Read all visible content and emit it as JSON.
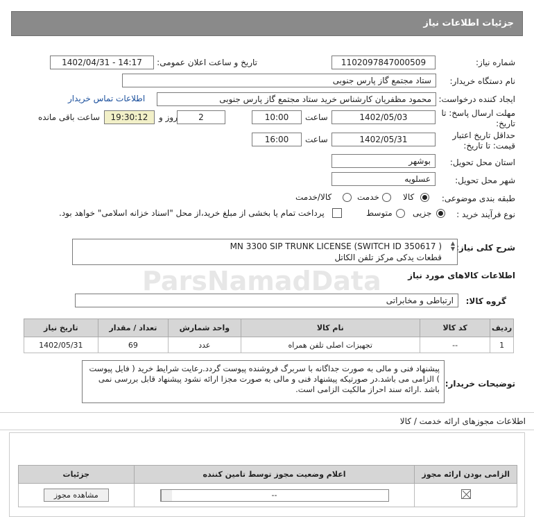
{
  "header": {
    "title": "جزئیات اطلاعات نیاز"
  },
  "form": {
    "need_number_label": "شماره نیاز:",
    "need_number": "1102097847000509",
    "announce_label": "تاریخ و ساعت اعلان عمومی:",
    "announce_value": "1402/04/31 - 14:17",
    "buyer_org_label": "نام دستگاه خریدار:",
    "buyer_org": "ستاد مجتمع گاز پارس جنوبی",
    "requester_label": "ایجاد کننده درخواست:",
    "requester": "محمود مظفریان کارشناس خرید ستاد مجتمع گاز پارس جنوبی",
    "contact_link": "اطلاعات تماس خریدار",
    "deadline_label": "مهلت ارسال پاسخ: تا",
    "deadline_label2": "تاریخ:",
    "deadline_date": "1402/05/03",
    "time_label": "ساعت",
    "deadline_time": "10:00",
    "days_value": "2",
    "days_label": "روز و",
    "remaining_time": "19:30:12",
    "remaining_label": "ساعت باقی مانده",
    "validity_label": "حداقل تاریخ اعتبار",
    "validity_label2": "قیمت: تا تاریخ:",
    "validity_date": "1402/05/31",
    "validity_time": "16:00",
    "province_label": "استان محل تحویل:",
    "province": "بوشهر",
    "city_label": "شهر محل تحویل:",
    "city": "عسلویه",
    "category_label": "طبقه بندی موضوعی:",
    "category_options": [
      "کالا",
      "خدمت",
      "کالا/خدمت"
    ],
    "purchase_type_label": "نوع فرآیند خرید :",
    "purchase_options": [
      "جزیی",
      "متوسط"
    ],
    "purchase_note": "پرداخت تمام یا بخشی از مبلغ خرید،از محل \"اسناد خزانه اسلامی\" خواهد بود."
  },
  "summary": {
    "label": "شرح کلی نیاز:",
    "line1": "MN 3300 SIP TRUNK LICENSE (SWITCH ID 350617 )",
    "line2": "قطعات یدکی مرکز تلفن الکاتل"
  },
  "goods": {
    "section_title": "اطلاعات کالاهای مورد نیاز",
    "group_label": "گروه کالا:",
    "group_value": "ارتباطی و مخابراتی",
    "columns": [
      "ردیف",
      "کد کالا",
      "نام کالا",
      "واحد شمارش",
      "تعداد / مقدار",
      "تاریخ نیاز"
    ],
    "rows": [
      {
        "row": "1",
        "code": "--",
        "name": "تجهیزات اصلی تلفن همراه",
        "unit": "عدد",
        "qty": "69",
        "date": "1402/05/31"
      }
    ]
  },
  "notes": {
    "label": "توضیحات خریدار:",
    "text": "پیشنهاد فنی و مالی به صورت جداگانه با سربرگ فروشنده پیوست گردد.رعایت شرایط خرید  ( فایل پیوست ) الزامی می باشد.در صورتیکه پیشنهاد فنی و مالی به صورت مجزا ارائه نشود پیشنهاد قابل بررسی نمی باشد .ارائه سند احراز مالکیت الزامی است."
  },
  "license": {
    "section_title": "اطلاعات مجوزهای ارائه خدمت / کالا",
    "columns": [
      "الزامی بودن ارائه مجوز",
      "اعلام وضعیت مجوز توسط تامین کننده",
      "جزئیات"
    ],
    "status_value": "--",
    "view_button": "مشاهده مجوز"
  },
  "watermark": {
    "brand": "ParsNamadData",
    "sub": "پایگاه اطلاع رسانی مناقصه و مزایده"
  }
}
